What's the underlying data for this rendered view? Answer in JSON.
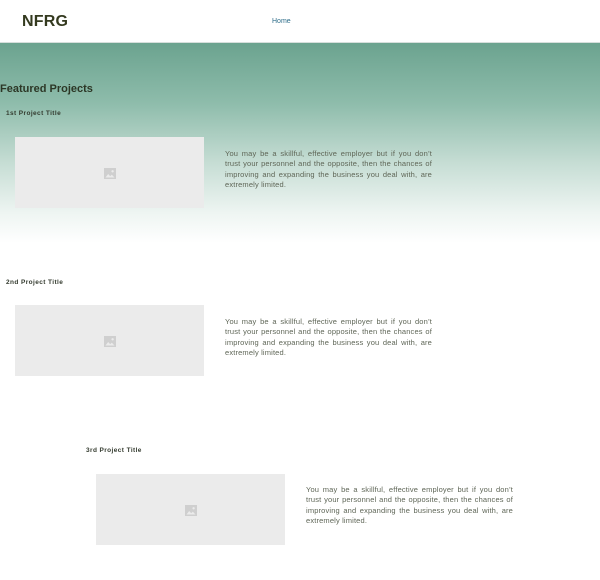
{
  "header": {
    "logo": "NFRG",
    "nav": {
      "home_label": "Home"
    }
  },
  "main": {
    "section_heading": "Featured Projects",
    "projects": [
      {
        "title": "1st Project Title",
        "description": "You may be a skillful, effective employer but if you don’t trust your personnel and the opposite, then the chances of improving and expanding the business you deal with, are extremely limited.",
        "image_icon": "image-placeholder-icon"
      },
      {
        "title": "2nd Project Title",
        "description": "You may be a skillful, effective employer but if you don’t trust your personnel and the opposite, then the chances of improving and expanding the business you deal with, are extremely limited.",
        "image_icon": "image-placeholder-icon"
      },
      {
        "title": "3rd Project Title",
        "description": "You may be a skillful, effective employer but if you don’t trust your personnel and the opposite, then the chances of improving and expanding the business you deal with, are extremely limited.",
        "image_icon": "image-placeholder-icon"
      }
    ]
  },
  "colors": {
    "hero_gradient_top": "#6ba38f",
    "logo": "#343a1f",
    "nav_link": "#2f6e8a",
    "image_placeholder_bg": "#ebebeb",
    "body_text": "#5f6657"
  }
}
